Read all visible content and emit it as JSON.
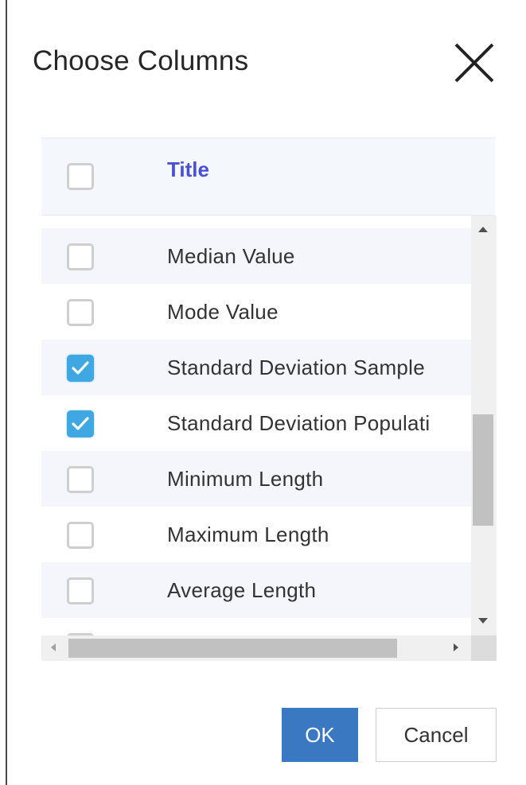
{
  "dialog": {
    "title": "Choose Columns",
    "close_icon": "close-icon"
  },
  "grid": {
    "header": {
      "label": "Title",
      "checked": false,
      "label_color": "#4a4fd8"
    },
    "rows": [
      {
        "label": "Median Value",
        "checked": false
      },
      {
        "label": "Mode Value",
        "checked": false
      },
      {
        "label": "Standard Deviation Sample",
        "checked": true
      },
      {
        "label": "Standard Deviation Populati",
        "checked": true
      },
      {
        "label": "Minimum Length",
        "checked": false
      },
      {
        "label": "Maximum Length",
        "checked": false
      },
      {
        "label": "Average Length",
        "checked": false
      }
    ],
    "vertical_scroll": {
      "thumb_start": 0.47,
      "thumb_size": 0.3
    },
    "horizontal_scroll": {
      "thumb_start": 0.0,
      "thumb_size": 0.86
    }
  },
  "buttons": {
    "ok_label": "OK",
    "cancel_label": "Cancel"
  },
  "colors": {
    "accent": "#3b78c2",
    "checkbox_checked": "#3fa7e2",
    "header_text": "#4a4fd8"
  }
}
